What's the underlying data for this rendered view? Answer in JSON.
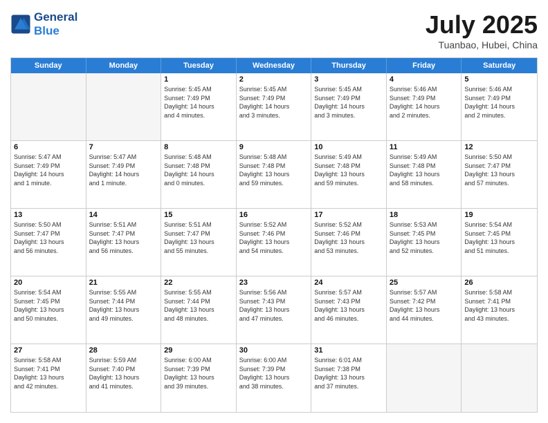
{
  "logo": {
    "line1": "General",
    "line2": "Blue"
  },
  "title": "July 2025",
  "subtitle": "Tuanbao, Hubei, China",
  "days": [
    "Sunday",
    "Monday",
    "Tuesday",
    "Wednesday",
    "Thursday",
    "Friday",
    "Saturday"
  ],
  "weeks": [
    [
      {
        "day": "",
        "info": ""
      },
      {
        "day": "",
        "info": ""
      },
      {
        "day": "1",
        "info": "Sunrise: 5:45 AM\nSunset: 7:49 PM\nDaylight: 14 hours\nand 4 minutes."
      },
      {
        "day": "2",
        "info": "Sunrise: 5:45 AM\nSunset: 7:49 PM\nDaylight: 14 hours\nand 3 minutes."
      },
      {
        "day": "3",
        "info": "Sunrise: 5:45 AM\nSunset: 7:49 PM\nDaylight: 14 hours\nand 3 minutes."
      },
      {
        "day": "4",
        "info": "Sunrise: 5:46 AM\nSunset: 7:49 PM\nDaylight: 14 hours\nand 2 minutes."
      },
      {
        "day": "5",
        "info": "Sunrise: 5:46 AM\nSunset: 7:49 PM\nDaylight: 14 hours\nand 2 minutes."
      }
    ],
    [
      {
        "day": "6",
        "info": "Sunrise: 5:47 AM\nSunset: 7:49 PM\nDaylight: 14 hours\nand 1 minute."
      },
      {
        "day": "7",
        "info": "Sunrise: 5:47 AM\nSunset: 7:49 PM\nDaylight: 14 hours\nand 1 minute."
      },
      {
        "day": "8",
        "info": "Sunrise: 5:48 AM\nSunset: 7:48 PM\nDaylight: 14 hours\nand 0 minutes."
      },
      {
        "day": "9",
        "info": "Sunrise: 5:48 AM\nSunset: 7:48 PM\nDaylight: 13 hours\nand 59 minutes."
      },
      {
        "day": "10",
        "info": "Sunrise: 5:49 AM\nSunset: 7:48 PM\nDaylight: 13 hours\nand 59 minutes."
      },
      {
        "day": "11",
        "info": "Sunrise: 5:49 AM\nSunset: 7:48 PM\nDaylight: 13 hours\nand 58 minutes."
      },
      {
        "day": "12",
        "info": "Sunrise: 5:50 AM\nSunset: 7:47 PM\nDaylight: 13 hours\nand 57 minutes."
      }
    ],
    [
      {
        "day": "13",
        "info": "Sunrise: 5:50 AM\nSunset: 7:47 PM\nDaylight: 13 hours\nand 56 minutes."
      },
      {
        "day": "14",
        "info": "Sunrise: 5:51 AM\nSunset: 7:47 PM\nDaylight: 13 hours\nand 56 minutes."
      },
      {
        "day": "15",
        "info": "Sunrise: 5:51 AM\nSunset: 7:47 PM\nDaylight: 13 hours\nand 55 minutes."
      },
      {
        "day": "16",
        "info": "Sunrise: 5:52 AM\nSunset: 7:46 PM\nDaylight: 13 hours\nand 54 minutes."
      },
      {
        "day": "17",
        "info": "Sunrise: 5:52 AM\nSunset: 7:46 PM\nDaylight: 13 hours\nand 53 minutes."
      },
      {
        "day": "18",
        "info": "Sunrise: 5:53 AM\nSunset: 7:45 PM\nDaylight: 13 hours\nand 52 minutes."
      },
      {
        "day": "19",
        "info": "Sunrise: 5:54 AM\nSunset: 7:45 PM\nDaylight: 13 hours\nand 51 minutes."
      }
    ],
    [
      {
        "day": "20",
        "info": "Sunrise: 5:54 AM\nSunset: 7:45 PM\nDaylight: 13 hours\nand 50 minutes."
      },
      {
        "day": "21",
        "info": "Sunrise: 5:55 AM\nSunset: 7:44 PM\nDaylight: 13 hours\nand 49 minutes."
      },
      {
        "day": "22",
        "info": "Sunrise: 5:55 AM\nSunset: 7:44 PM\nDaylight: 13 hours\nand 48 minutes."
      },
      {
        "day": "23",
        "info": "Sunrise: 5:56 AM\nSunset: 7:43 PM\nDaylight: 13 hours\nand 47 minutes."
      },
      {
        "day": "24",
        "info": "Sunrise: 5:57 AM\nSunset: 7:43 PM\nDaylight: 13 hours\nand 46 minutes."
      },
      {
        "day": "25",
        "info": "Sunrise: 5:57 AM\nSunset: 7:42 PM\nDaylight: 13 hours\nand 44 minutes."
      },
      {
        "day": "26",
        "info": "Sunrise: 5:58 AM\nSunset: 7:41 PM\nDaylight: 13 hours\nand 43 minutes."
      }
    ],
    [
      {
        "day": "27",
        "info": "Sunrise: 5:58 AM\nSunset: 7:41 PM\nDaylight: 13 hours\nand 42 minutes."
      },
      {
        "day": "28",
        "info": "Sunrise: 5:59 AM\nSunset: 7:40 PM\nDaylight: 13 hours\nand 41 minutes."
      },
      {
        "day": "29",
        "info": "Sunrise: 6:00 AM\nSunset: 7:39 PM\nDaylight: 13 hours\nand 39 minutes."
      },
      {
        "day": "30",
        "info": "Sunrise: 6:00 AM\nSunset: 7:39 PM\nDaylight: 13 hours\nand 38 minutes."
      },
      {
        "day": "31",
        "info": "Sunrise: 6:01 AM\nSunset: 7:38 PM\nDaylight: 13 hours\nand 37 minutes."
      },
      {
        "day": "",
        "info": ""
      },
      {
        "day": "",
        "info": ""
      }
    ]
  ]
}
